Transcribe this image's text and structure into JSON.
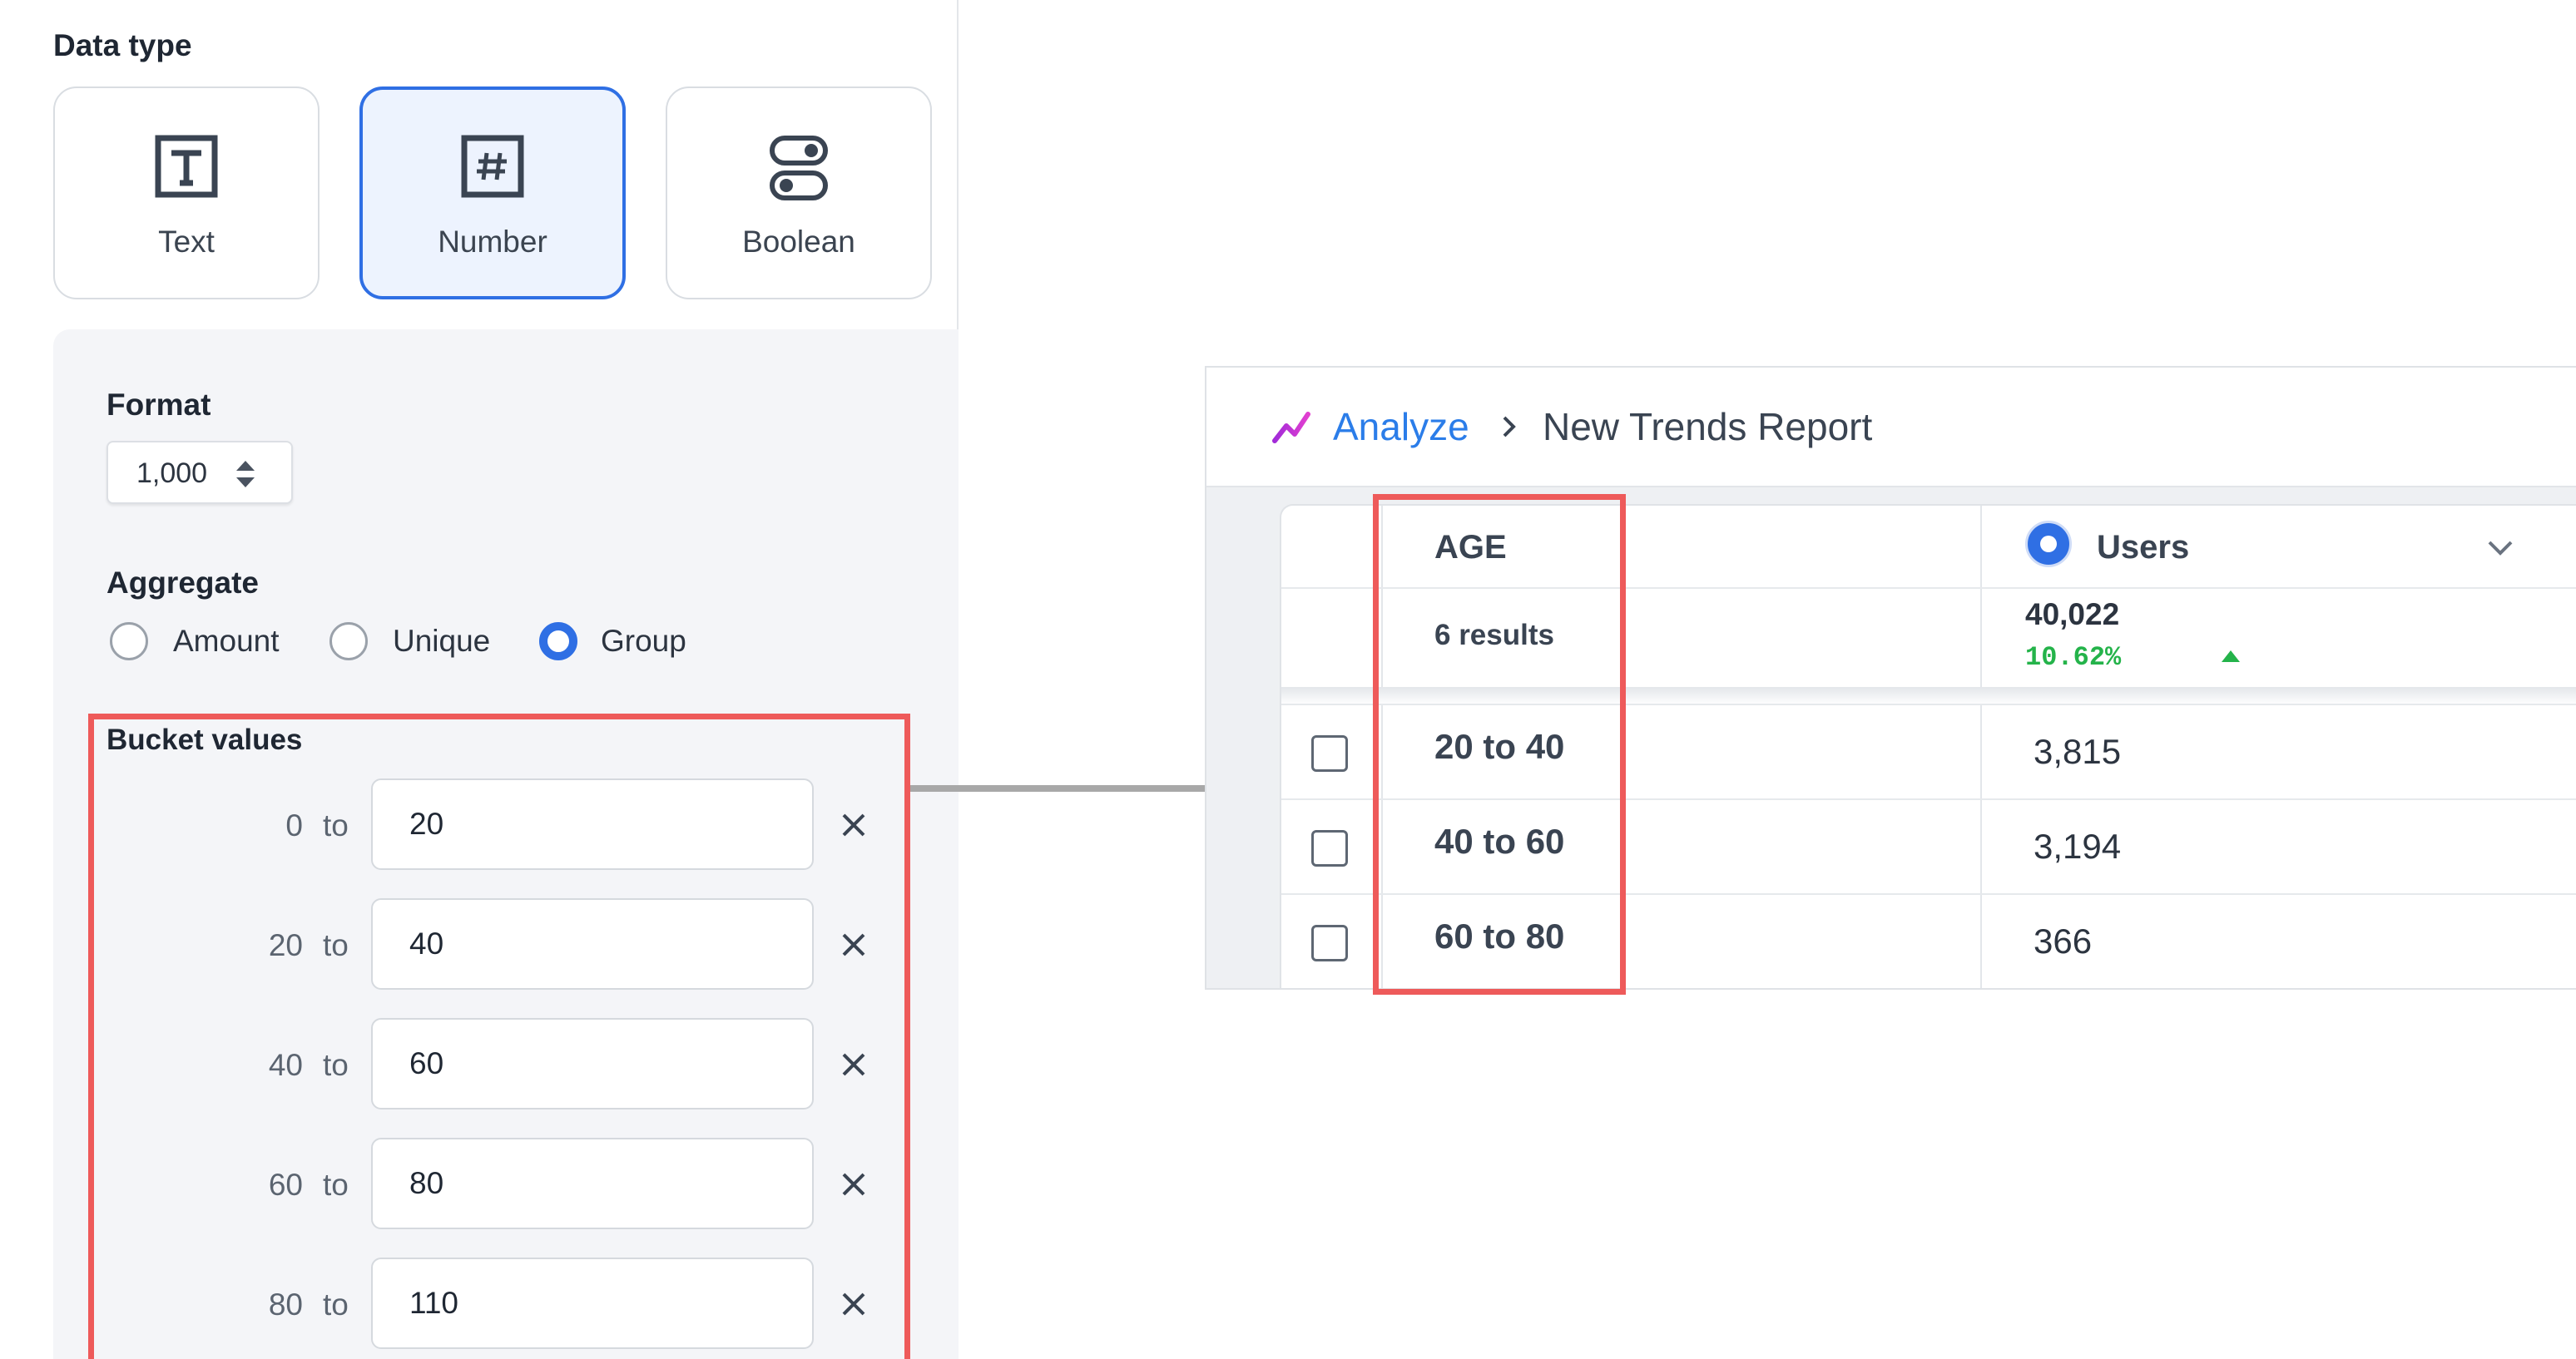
{
  "data_type": {
    "label": "Data type",
    "options": [
      {
        "label": "Text",
        "icon": "text-icon",
        "selected": false
      },
      {
        "label": "Number",
        "icon": "hash-icon",
        "selected": true
      },
      {
        "label": "Boolean",
        "icon": "toggle-icon",
        "selected": false
      }
    ]
  },
  "format": {
    "label": "Format",
    "value": "1,000"
  },
  "aggregate": {
    "label": "Aggregate",
    "options": [
      {
        "label": "Amount",
        "checked": false
      },
      {
        "label": "Unique",
        "checked": false
      },
      {
        "label": "Group",
        "checked": true
      }
    ]
  },
  "buckets": {
    "label": "Bucket values",
    "separator": "to",
    "rows": [
      {
        "from": "0",
        "to": "20"
      },
      {
        "from": "20",
        "to": "40"
      },
      {
        "from": "40",
        "to": "60"
      },
      {
        "from": "60",
        "to": "80"
      },
      {
        "from": "80",
        "to": "110"
      }
    ]
  },
  "report": {
    "breadcrumb_link": "Analyze",
    "breadcrumb_current": "New Trends Report",
    "table": {
      "age_header": "AGE",
      "users_header": "Users",
      "results": "6 results",
      "total_users": "40,022",
      "delta": "10.62%",
      "rows": [
        {
          "age": "20 to 40",
          "users": "3,815"
        },
        {
          "age": "40 to 60",
          "users": "3,194"
        },
        {
          "age": "60 to 80",
          "users": "366"
        }
      ]
    }
  },
  "colors": {
    "accent": "#2f6fe4",
    "highlight": "#ee5a5a",
    "link": "#2b7de9",
    "positive": "#24b34a"
  }
}
